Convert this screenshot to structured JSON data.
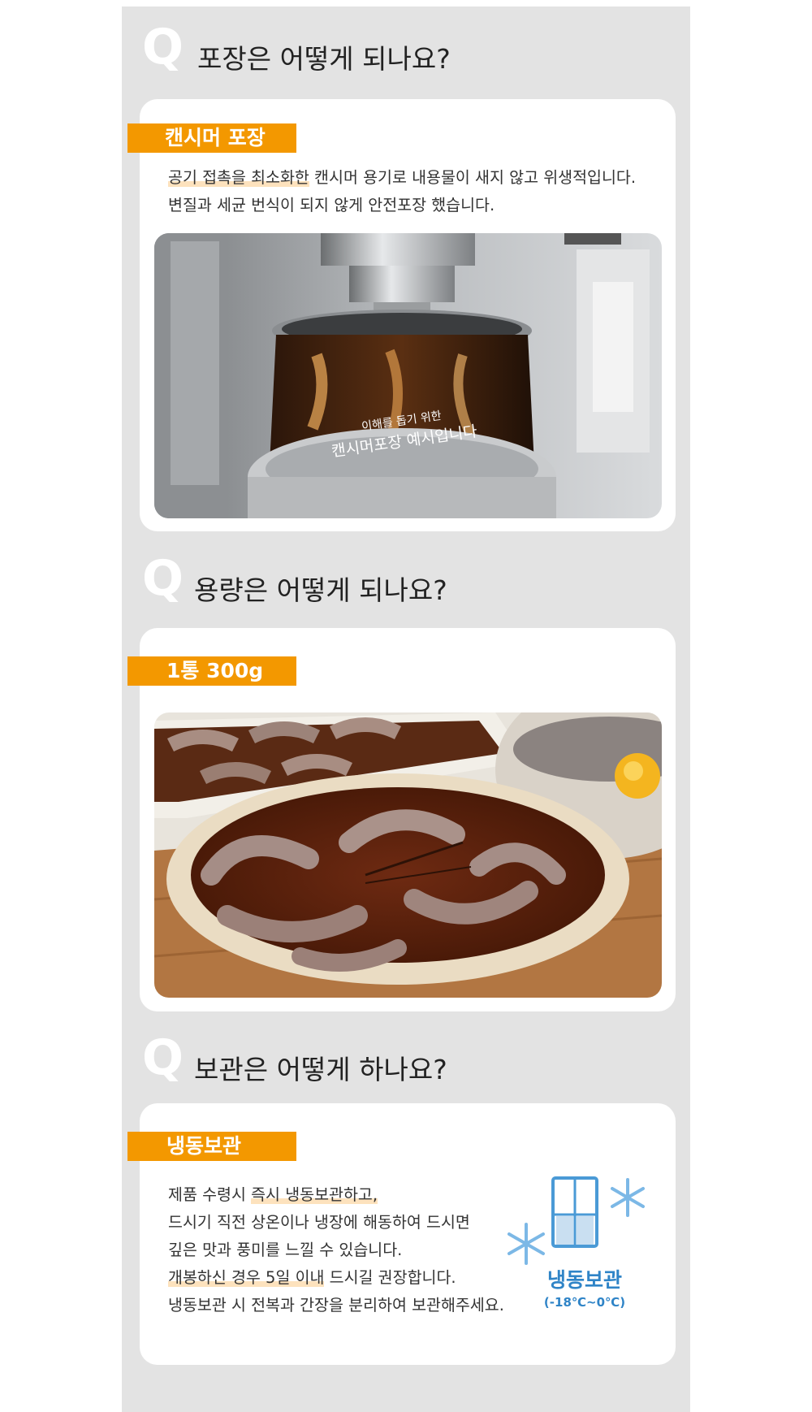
{
  "colors": {
    "panel_bg": "#e3e3e3",
    "accent": "#f39800",
    "highlight": "#fde2bd",
    "freezer_blue": "#2f84c7"
  },
  "q_mark": "Q",
  "sections": {
    "packaging": {
      "question": "포장은 어떻게 되나요?",
      "tag": "캔시머 포장",
      "desc_line1_hl": "공기 접촉을 최소화한",
      "desc_line1_rest": " 캔시머 용기로 내용물이 새지 않고 위생적입니다.",
      "desc_line2": "변질과 세균 번식이 되지 않게 안전포장 했습니다.",
      "photo_caption_small": "이해를 돕기 위한",
      "photo_caption_large": "캔시머포장  예시입니다"
    },
    "volume": {
      "question": "용량은 어떻게 되나요?",
      "tag": "1통 300g"
    },
    "storage": {
      "question": "보관은 어떻게 하나요?",
      "tag": "냉동보관",
      "line1_pre": "제품 수령시 ",
      "line1_hl": "즉시 냉동보관하고,",
      "line2": "드시기 직전 상온이나 냉장에 해동하여 드시면",
      "line3": "깊은 맛과 풍미를 느낄 수 있습니다.",
      "line4_hl": "개봉하신 경우 5일 이내",
      "line4_rest": " 드시길 권장합니다.",
      "line5": "냉동보관 시 전복과 간장을 분리하여 보관해주세요.",
      "freezer_label": "냉동보관",
      "freezer_range": "(-18℃~0℃)",
      "freezer_icon": "freezer-icon",
      "snowflake_icon": "snowflake-icon"
    }
  }
}
